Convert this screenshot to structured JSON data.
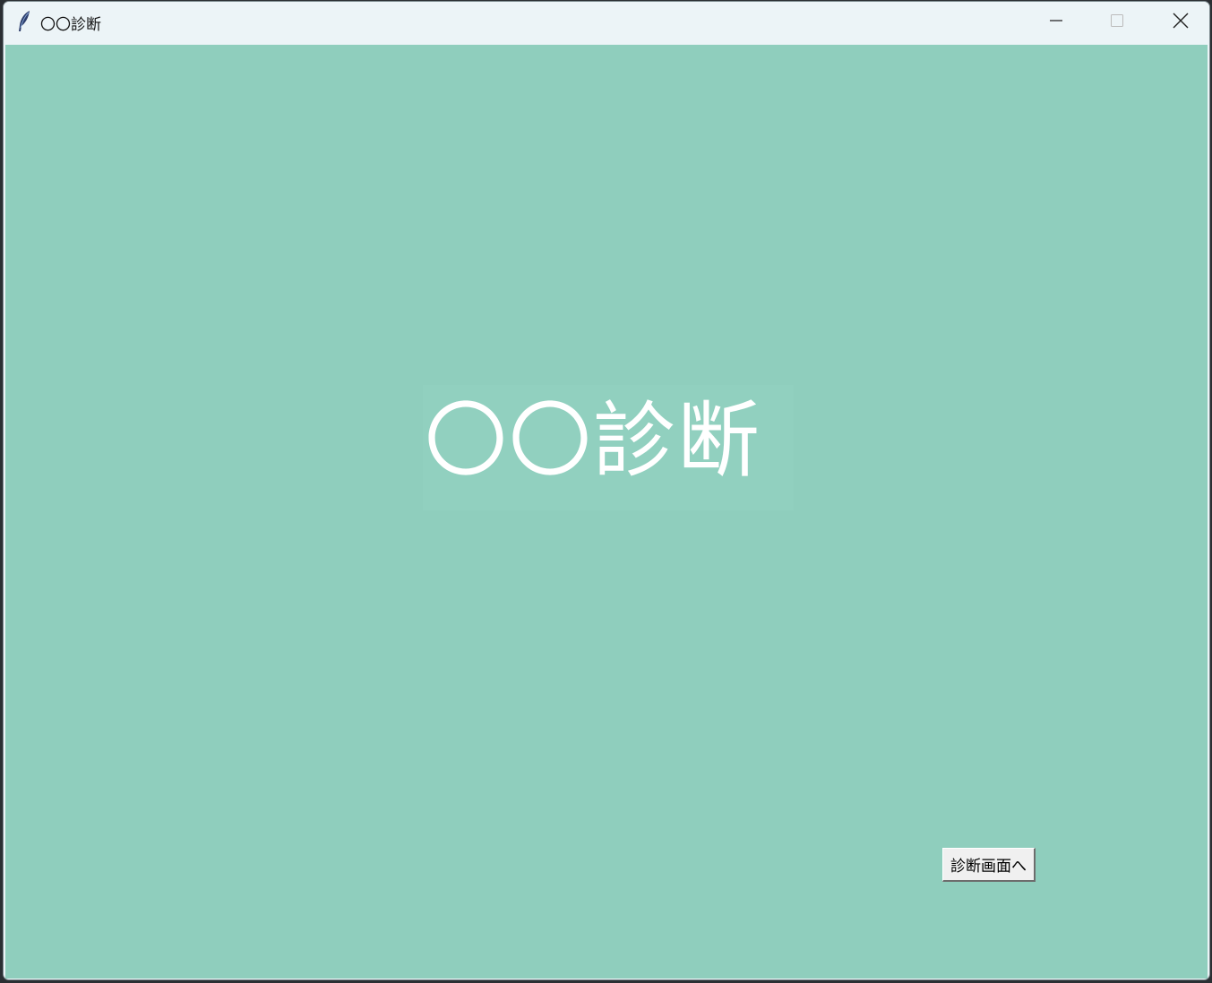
{
  "window": {
    "title": "〇〇診断",
    "controls": {
      "minimize_icon": "minimize-icon",
      "maximize_icon": "maximize-icon",
      "close_icon": "close-icon"
    }
  },
  "main": {
    "heading": "〇〇診断",
    "next_button_label": "診断画面へ"
  },
  "colors": {
    "background": "#8fcebd",
    "titlebar": "#ecf4f7",
    "heading_text": "#ffffff"
  }
}
